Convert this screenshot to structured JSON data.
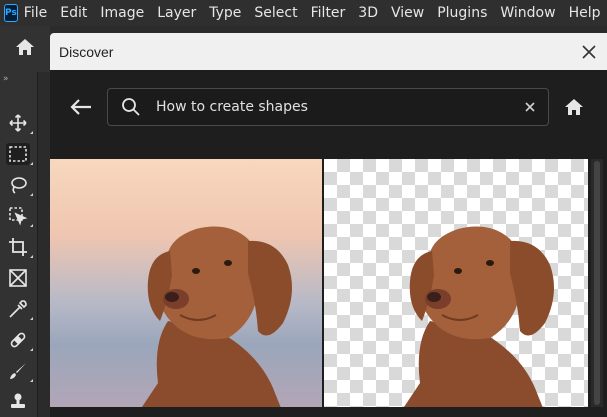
{
  "app": {
    "logo": "Ps"
  },
  "menubar": {
    "items": [
      "File",
      "Edit",
      "Image",
      "Layer",
      "Type",
      "Select",
      "Filter",
      "3D",
      "View",
      "Plugins",
      "Window",
      "Help"
    ]
  },
  "toolbar": {
    "collapse_glyph": "»",
    "tools": [
      "move-tool-icon",
      "rectangular-marquee-icon",
      "lasso-icon",
      "object-selection-icon",
      "crop-icon",
      "frame-icon",
      "eyedropper-icon",
      "healing-brush-icon",
      "brush-icon",
      "stamp-icon"
    ]
  },
  "dialog": {
    "title": "Discover",
    "search": {
      "value": "How to create shapes"
    }
  },
  "colors": {
    "menubar_bg": "#2f2f2f",
    "dialog_bg": "#1e1e1e",
    "titlebar_bg": "#f0f0f0",
    "dog": "#9b5a34"
  }
}
